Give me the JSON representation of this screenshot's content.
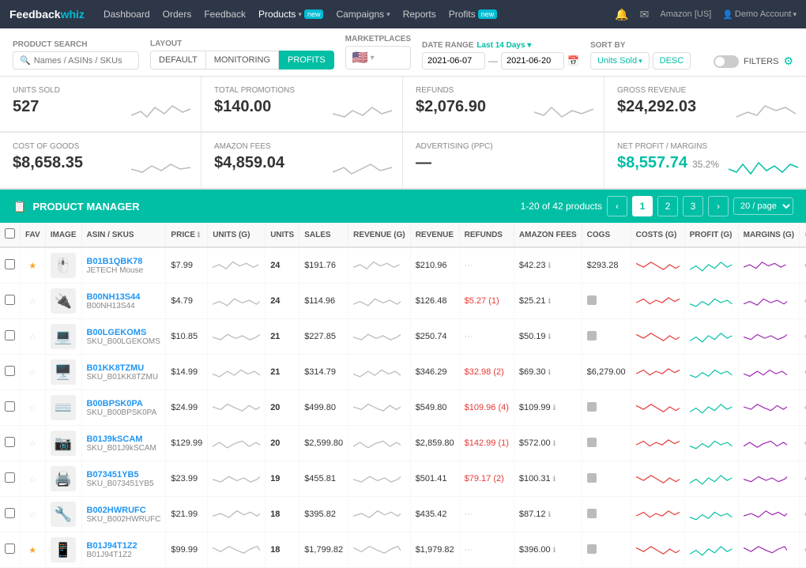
{
  "brand": "Feedback",
  "brand_accent": "whiz",
  "nav": {
    "links": [
      {
        "label": "Dashboard",
        "active": false
      },
      {
        "label": "Orders",
        "active": false
      },
      {
        "label": "Feedback",
        "active": false
      },
      {
        "label": "Products",
        "active": true,
        "badge": "new"
      },
      {
        "label": "Campaigns",
        "active": false
      },
      {
        "label": "Reports",
        "active": false
      },
      {
        "label": "Profits",
        "active": false,
        "badge": "new"
      }
    ],
    "amazon_region": "Amazon [US]",
    "user": "Demo Account"
  },
  "filters": {
    "product_search_label": "PRODUCT SEARCH",
    "product_search_placeholder": "Names / ASINs / SKUs",
    "layout_label": "LAYOUT",
    "layout_options": [
      "DEFAULT",
      "MONITORING",
      "PROFITS"
    ],
    "layout_active": "PROFITS",
    "marketplaces_label": "MARKETPLACES",
    "date_range_label": "DATE RANGE",
    "date_range_preset": "Last 14 Days",
    "date_from": "2021-06-07",
    "date_to": "2021-06-20",
    "sort_by_label": "SORT BY",
    "sort_field": "Units Sold",
    "sort_dir": "DESC",
    "filters_label": "FILTERS"
  },
  "summary": [
    {
      "label": "UNITS SOLD",
      "value": "527",
      "sub": null
    },
    {
      "label": "TOTAL PROMOTIONS",
      "value": "$140.00",
      "sub": null
    },
    {
      "label": "REFUNDS",
      "value": "$2,076.90",
      "sub": null
    },
    {
      "label": "GROSS REVENUE",
      "value": "$24,292.03",
      "sub": null
    },
    {
      "label": "COST OF GOODS",
      "value": "$8,658.35",
      "sub": null
    },
    {
      "label": "AMAZON FEES",
      "value": "$4,859.04",
      "sub": null
    },
    {
      "label": "ADVERTISING (PPC)",
      "value": "—",
      "sub": null
    },
    {
      "label": "NET PROFIT / MARGINS",
      "value": "$8,557.74",
      "sub": "35.2%",
      "green": true
    }
  ],
  "product_manager": {
    "title": "PRODUCT MANAGER",
    "count_text": "1-20 of 42 products",
    "pages": [
      "1",
      "2",
      "3"
    ],
    "per_page": "20 / page"
  },
  "table": {
    "headers": [
      "",
      "FAV",
      "IMAGE",
      "ASIN / SKUS",
      "PRICE",
      "UNITS (G)",
      "UNITS",
      "SALES",
      "REVENUE (G)",
      "REVENUE",
      "REFUNDS",
      "AMAZON FEES",
      "COGS",
      "COSTS (G)",
      "PROFIT (G)",
      "MARGINS (G)",
      "⚙"
    ],
    "rows": [
      {
        "checked": false,
        "fav": true,
        "img": "🖱️",
        "asin": "B01B1QBK78",
        "sku": "JETECH Mouse",
        "price": "$7.99",
        "units_g": "",
        "units": "24",
        "sales": "$191.76",
        "revenue_g": "",
        "revenue": "$210.96",
        "refunds": "···",
        "amazon_fees": "$42.23",
        "cogs": "$293.28",
        "costs_g": "",
        "profit_g": "",
        "margins_g": ""
      },
      {
        "checked": false,
        "fav": false,
        "img": "🔌",
        "asin": "B00NH13S44",
        "sku": "B00NH13S44",
        "price": "$4.79",
        "units_g": "",
        "units": "24",
        "sales": "$114.96",
        "revenue_g": "",
        "revenue": "$126.48",
        "refunds": "$5.27 (1)",
        "amazon_fees": "$25.21",
        "cogs": "",
        "costs_g": "",
        "profit_g": "",
        "margins_g": ""
      },
      {
        "checked": false,
        "fav": false,
        "img": "💻",
        "asin": "B00LGEKOMS",
        "sku": "SKU_B00LGEKOMS",
        "price": "$10.85",
        "units_g": "",
        "units": "21",
        "sales": "$227.85",
        "revenue_g": "",
        "revenue": "$250.74",
        "refunds": "···",
        "amazon_fees": "$50.19",
        "cogs": "",
        "costs_g": "",
        "profit_g": "",
        "margins_g": ""
      },
      {
        "checked": false,
        "fav": false,
        "img": "🖥️",
        "asin": "B01KK8TZMU",
        "sku": "SKU_B01KK8TZMU",
        "price": "$14.99",
        "units_g": "",
        "units": "21",
        "sales": "$314.79",
        "revenue_g": "",
        "revenue": "$346.29",
        "refunds": "$32.98 (2)",
        "amazon_fees": "$69.30",
        "cogs": "$6,279.00",
        "costs_g": "",
        "profit_g": "",
        "margins_g": ""
      },
      {
        "checked": false,
        "fav": false,
        "img": "⌨️",
        "asin": "B00BPSK0PA",
        "sku": "SKU_B00BPSK0PA",
        "price": "$24.99",
        "units_g": "",
        "units": "20",
        "sales": "$499.80",
        "revenue_g": "",
        "revenue": "$549.80",
        "refunds": "$109.96 (4)",
        "amazon_fees": "$109.99",
        "cogs": "",
        "costs_g": "",
        "profit_g": "",
        "margins_g": ""
      },
      {
        "checked": false,
        "fav": false,
        "img": "📷",
        "asin": "B01J9kSCAM",
        "sku": "SKU_B01J9kSCAM",
        "price": "$129.99",
        "units_g": "",
        "units": "20",
        "sales": "$2,599.80",
        "revenue_g": "",
        "revenue": "$2,859.80",
        "refunds": "$142.99 (1)",
        "amazon_fees": "$572.00",
        "cogs": "",
        "costs_g": "",
        "profit_g": "",
        "margins_g": ""
      },
      {
        "checked": false,
        "fav": false,
        "img": "🖨️",
        "asin": "B073451YB5",
        "sku": "SKU_B073451YB5",
        "price": "$23.99",
        "units_g": "",
        "units": "19",
        "sales": "$455.81",
        "revenue_g": "",
        "revenue": "$501.41",
        "refunds": "$79.17 (2)",
        "amazon_fees": "$100.31",
        "cogs": "",
        "costs_g": "",
        "profit_g": "",
        "margins_g": ""
      },
      {
        "checked": false,
        "fav": false,
        "img": "🔧",
        "asin": "B002HWRUFC",
        "sku": "SKU_B002HWRUFC",
        "price": "$21.99",
        "units_g": "",
        "units": "18",
        "sales": "$395.82",
        "revenue_g": "",
        "revenue": "$435.42",
        "refunds": "···",
        "amazon_fees": "$87.12",
        "cogs": "",
        "costs_g": "",
        "profit_g": "",
        "margins_g": ""
      },
      {
        "checked": false,
        "fav": true,
        "img": "📱",
        "asin": "B01J94T1Z2",
        "sku": "B01J94T1Z2",
        "price": "$99.99",
        "units_g": "",
        "units": "18",
        "sales": "$1,799.82",
        "revenue_g": "",
        "revenue": "$1,979.82",
        "refunds": "···",
        "amazon_fees": "$396.00",
        "cogs": "",
        "costs_g": "",
        "profit_g": "",
        "margins_g": ""
      }
    ]
  }
}
